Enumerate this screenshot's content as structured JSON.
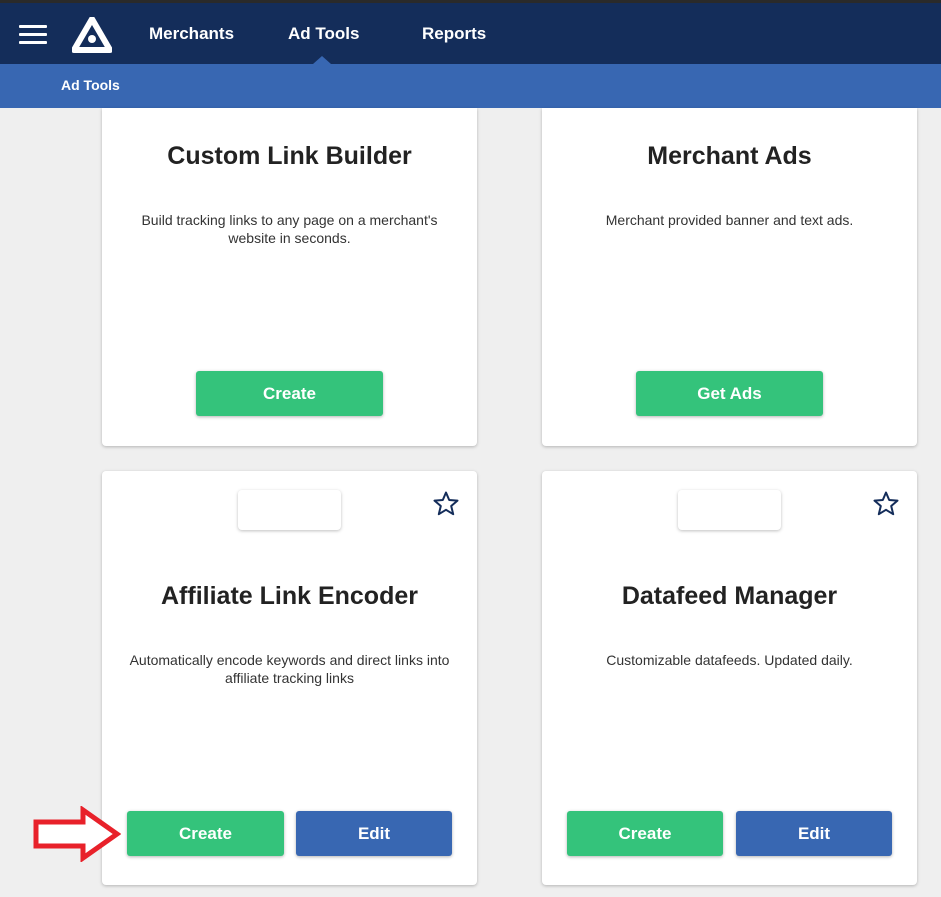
{
  "header": {
    "nav": [
      "Merchants",
      "Ad Tools",
      "Reports"
    ],
    "active_nav": "Ad Tools",
    "breadcrumb": "Ad Tools"
  },
  "colors": {
    "navbar": "#142d5a",
    "subbar": "#3867b2",
    "green_button": "#34c37b",
    "blue_button": "#3867b2",
    "annotation_arrow": "#e8212a"
  },
  "cards": [
    {
      "title": "Custom Link Builder",
      "description": "Build tracking links to any page on a merchant's website in seconds.",
      "buttons": [
        "Create"
      ]
    },
    {
      "title": "Merchant Ads",
      "description": "Merchant provided banner and text ads.",
      "buttons": [
        "Get Ads"
      ]
    },
    {
      "title": "Affiliate Link Encoder",
      "description": "Automatically encode keywords and direct links into affiliate tracking links",
      "buttons": [
        "Create",
        "Edit"
      ],
      "icon": "star-outline-icon"
    },
    {
      "title": "Datafeed Manager",
      "description": "Customizable datafeeds. Updated daily.",
      "buttons": [
        "Create",
        "Edit"
      ],
      "icon": "star-outline-icon"
    }
  ]
}
